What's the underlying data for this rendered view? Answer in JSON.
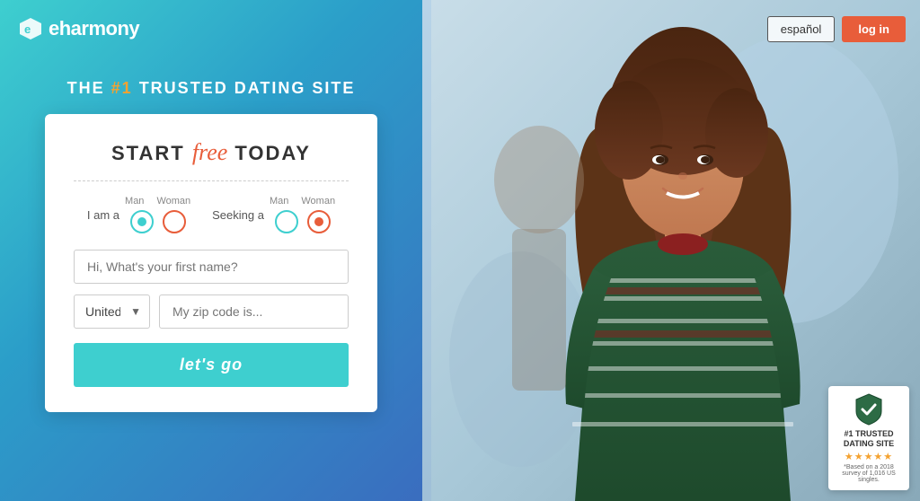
{
  "logo": {
    "text": "eharmony"
  },
  "header": {
    "tagline_pre": "THE ",
    "tagline_num": "#1",
    "tagline_post": " TRUSTED DATING SITE"
  },
  "card": {
    "title_pre": "START ",
    "title_free": "free",
    "title_post": " TODAY",
    "iam_label": "I am a",
    "seeking_label": "Seeking a",
    "man_label": "Man",
    "woman_label": "Woman",
    "name_placeholder": "Hi, What's your first name?",
    "country_value": "United States",
    "zip_placeholder": "My zip code is...",
    "cta_label": "let's go"
  },
  "nav": {
    "espanol_label": "español",
    "login_label": "log in"
  },
  "trust_badge": {
    "line1": "#1 TRUSTED",
    "line2": "DATING SITE",
    "note": "*Based on a 2018 survey of 1,016 US singles.",
    "stars": "★★★★★"
  }
}
